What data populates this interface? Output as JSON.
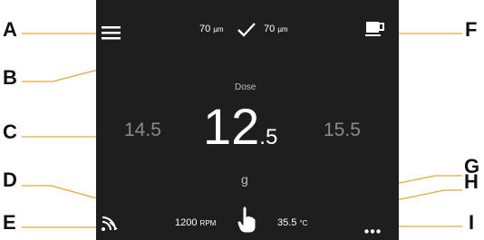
{
  "callouts": {
    "A": "A",
    "B": "B",
    "C": "C",
    "D": "D",
    "E": "E",
    "F": "F",
    "G": "G",
    "H": "H",
    "I": "I"
  },
  "grind": {
    "left_value": "70",
    "left_unit": "µm",
    "right_value": "70",
    "right_unit": "µm"
  },
  "dose": {
    "label": "Dose",
    "current_int": "12",
    "current_dec": ".5",
    "prev": "14.5",
    "next": "15.5",
    "unit": "g"
  },
  "status": {
    "rpm_value": "1200",
    "rpm_unit": "RPM",
    "temp_value": "35.5",
    "temp_unit": "°C"
  },
  "icons": [
    "menu-icon",
    "check-icon",
    "cup-icon",
    "wifi-icon",
    "hand-pointer-icon",
    "more-icon"
  ],
  "colors": {
    "screen": "#1e1e1e",
    "callout_line": "#e3a93a",
    "accent": "#ffffff",
    "dim": "#8a8a8a"
  }
}
